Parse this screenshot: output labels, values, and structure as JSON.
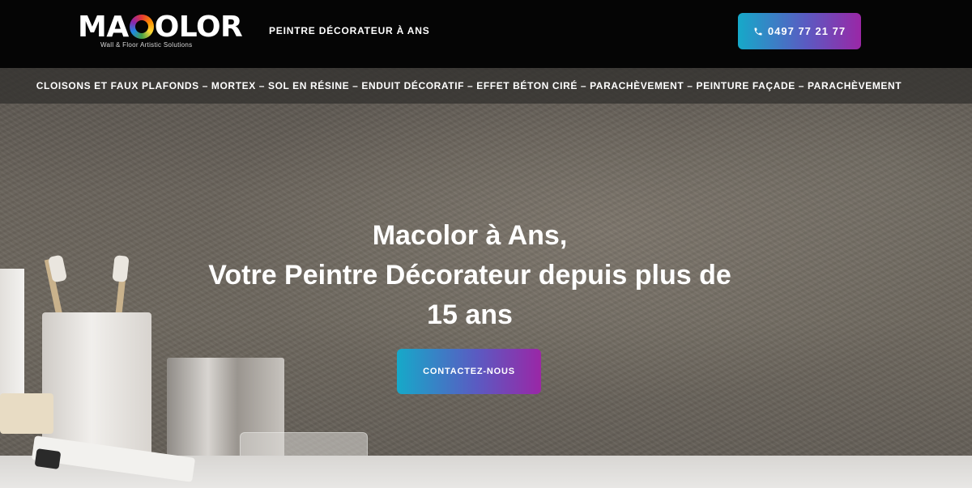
{
  "header": {
    "logo": {
      "text": "MACOLOR",
      "tagline": "Wall & Floor Artistic Solutions"
    },
    "title": "PEINTRE DÉCORATEUR À ANS",
    "phone_button": {
      "label": "0497 77 21 77",
      "icon": "phone-icon"
    }
  },
  "nav": {
    "services_line": "CLOISONS ET FAUX PLAFONDS – MORTEX – SOL EN RÉSINE – ENDUIT DÉCORATIF – EFFET BÉTON CIRÉ – PARACHÈVEMENT – PEINTURE FAÇADE – PARACHÈVEMENT"
  },
  "hero": {
    "title_lines": [
      "Macolor à Ans,",
      "Votre Peintre Décorateur depuis plus de",
      "15 ans"
    ],
    "cta_label": "CONTACTEZ-NOUS"
  },
  "colors": {
    "header_bg": "#050505",
    "button_gradient_start": "#16a9c9",
    "button_gradient_end": "#9a27a6",
    "text": "#ffffff"
  }
}
